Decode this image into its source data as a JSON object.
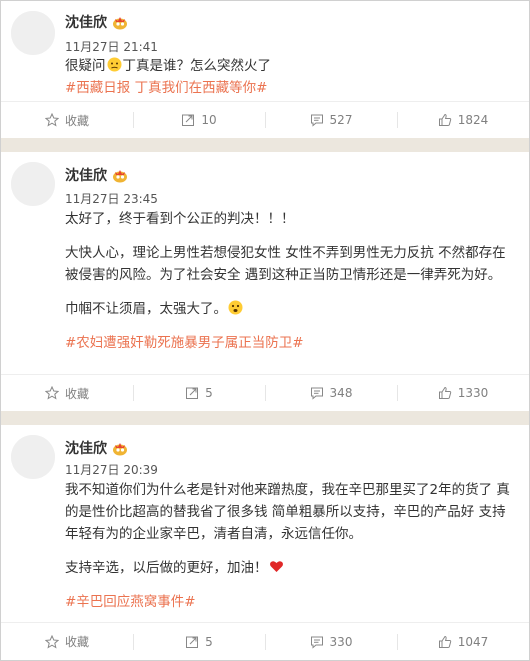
{
  "posts": [
    {
      "author": "沈佳欣",
      "time": "11月27日 21:41",
      "text_before": "很疑问",
      "text_after": "丁真是谁？怎么突然火了",
      "tags": "#西藏日报 丁真我们在西藏等你#",
      "actions": {
        "favorite": "收藏",
        "repost": "10",
        "comment": "527",
        "like": "1824"
      }
    },
    {
      "author": "沈佳欣",
      "time": "11月27日 23:45",
      "line1": "太好了，终于看到个公正的判决！！！",
      "line2": "大快人心，理论上男性若想侵犯女性 女性不弄到男性无力反抗 不然都存在被侵害的风险。为了社会安全 遇到这种正当防卫情形还是一律弄死为好。",
      "line3": "巾帼不让须眉，太强大了。",
      "tags": "#农妇遭强奸勒死施暴男子属正当防卫#",
      "actions": {
        "favorite": "收藏",
        "repost": "5",
        "comment": "348",
        "like": "1330"
      }
    },
    {
      "author": "沈佳欣",
      "time": "11月27日 20:39",
      "line1": "我不知道你们为什么老是针对他来蹭热度，我在辛巴那里买了2年的货了 真的是性价比超高的替我省了很多钱 简单粗暴所以支持，辛巴的产品好 支持年轻有为的企业家辛巴，清者自清，永远信任你。",
      "line2": "支持辛选，以后做的更好，加油！",
      "tags": "#辛巴回应燕窝事件#",
      "actions": {
        "favorite": "收藏",
        "repost": "5",
        "comment": "330",
        "like": "1047"
      }
    }
  ],
  "icons": {
    "favorite": "star-icon",
    "repost": "repost-icon",
    "comment": "comment-icon",
    "like": "thumbs-up-icon",
    "vip": "vip-badge-icon"
  },
  "colors": {
    "tag": "#eb7350",
    "background": "#ece7de",
    "text": "#333333",
    "muted": "#808080"
  }
}
